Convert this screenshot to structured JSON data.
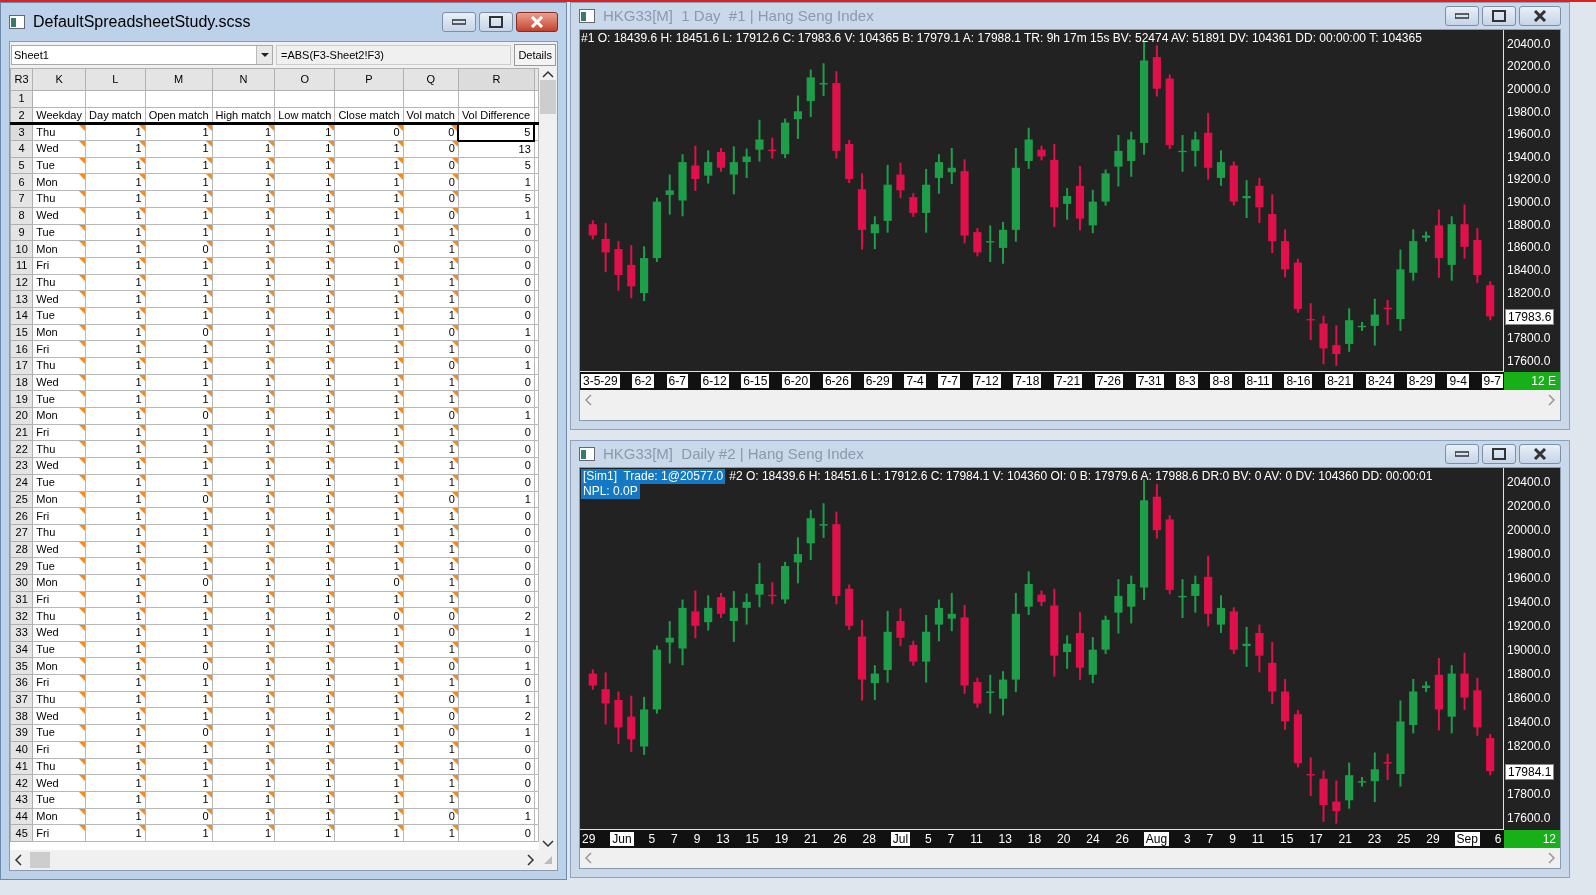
{
  "spreadsheet_window": {
    "title": "DefaultSpreadsheetStudy.scss",
    "active": true,
    "sheet_selector": "Sheet1",
    "formula": "=ABS(F3-Sheet2!F3)",
    "details_button": "Details",
    "cell_reference": "R3",
    "columns": [
      {
        "label": "K",
        "marked": true,
        "selected": false
      },
      {
        "label": "L",
        "marked": true,
        "selected": false
      },
      {
        "label": "M",
        "marked": true,
        "selected": false
      },
      {
        "label": "N",
        "marked": true,
        "selected": false
      },
      {
        "label": "O",
        "marked": true,
        "selected": false
      },
      {
        "label": "P",
        "marked": true,
        "selected": false
      },
      {
        "label": "Q",
        "marked": true,
        "selected": false
      },
      {
        "label": "R",
        "marked": false,
        "selected": true
      }
    ],
    "rows": [
      {
        "header": "1",
        "kind": "blank",
        "selected": false
      },
      {
        "header": "2",
        "kind": "header",
        "selected": false,
        "cells": [
          "Weekday",
          "Day match",
          "Open match",
          "High match",
          "Low match",
          "Close match",
          "Vol match",
          "Vol Difference"
        ]
      },
      {
        "header": "3",
        "kind": "data",
        "selected": true,
        "cells": [
          "Thu",
          "1",
          "1",
          "1",
          "1",
          "0",
          "0",
          "5"
        ]
      },
      {
        "header": "4",
        "kind": "data",
        "selected": false,
        "cells": [
          "Wed",
          "1",
          "1",
          "1",
          "1",
          "1",
          "0",
          "13"
        ]
      },
      {
        "header": "5",
        "kind": "data",
        "selected": false,
        "cells": [
          "Tue",
          "1",
          "1",
          "1",
          "1",
          "1",
          "0",
          "5"
        ]
      },
      {
        "header": "6",
        "kind": "data",
        "selected": false,
        "cells": [
          "Mon",
          "1",
          "1",
          "1",
          "1",
          "1",
          "0",
          "1"
        ]
      },
      {
        "header": "7",
        "kind": "data",
        "selected": false,
        "cells": [
          "Thu",
          "1",
          "1",
          "1",
          "1",
          "1",
          "0",
          "5"
        ]
      },
      {
        "header": "8",
        "kind": "data",
        "selected": false,
        "cells": [
          "Wed",
          "1",
          "1",
          "1",
          "1",
          "1",
          "0",
          "1"
        ]
      },
      {
        "header": "9",
        "kind": "data",
        "selected": false,
        "cells": [
          "Tue",
          "1",
          "1",
          "1",
          "1",
          "1",
          "1",
          "0"
        ]
      },
      {
        "header": "10",
        "kind": "data",
        "selected": false,
        "cells": [
          "Mon",
          "1",
          "0",
          "1",
          "1",
          "0",
          "1",
          "0"
        ]
      },
      {
        "header": "11",
        "kind": "data",
        "selected": false,
        "cells": [
          "Fri",
          "1",
          "1",
          "1",
          "1",
          "1",
          "1",
          "0"
        ]
      },
      {
        "header": "12",
        "kind": "data",
        "selected": false,
        "cells": [
          "Thu",
          "1",
          "1",
          "1",
          "1",
          "1",
          "1",
          "0"
        ]
      },
      {
        "header": "13",
        "kind": "data",
        "selected": false,
        "cells": [
          "Wed",
          "1",
          "1",
          "1",
          "1",
          "1",
          "1",
          "0"
        ]
      },
      {
        "header": "14",
        "kind": "data",
        "selected": false,
        "cells": [
          "Tue",
          "1",
          "1",
          "1",
          "1",
          "1",
          "1",
          "0"
        ]
      },
      {
        "header": "15",
        "kind": "data",
        "selected": false,
        "cells": [
          "Mon",
          "1",
          "0",
          "1",
          "1",
          "1",
          "0",
          "1"
        ]
      },
      {
        "header": "16",
        "kind": "data",
        "selected": false,
        "cells": [
          "Fri",
          "1",
          "1",
          "1",
          "1",
          "1",
          "1",
          "0"
        ]
      },
      {
        "header": "17",
        "kind": "data",
        "selected": false,
        "cells": [
          "Thu",
          "1",
          "1",
          "1",
          "1",
          "1",
          "0",
          "1"
        ]
      },
      {
        "header": "18",
        "kind": "data",
        "selected": false,
        "cells": [
          "Wed",
          "1",
          "1",
          "1",
          "1",
          "1",
          "1",
          "0"
        ]
      },
      {
        "header": "19",
        "kind": "data",
        "selected": false,
        "cells": [
          "Tue",
          "1",
          "1",
          "1",
          "1",
          "1",
          "1",
          "0"
        ]
      },
      {
        "header": "20",
        "kind": "data",
        "selected": false,
        "cells": [
          "Mon",
          "1",
          "0",
          "1",
          "1",
          "1",
          "0",
          "1"
        ]
      },
      {
        "header": "21",
        "kind": "data",
        "selected": false,
        "cells": [
          "Fri",
          "1",
          "1",
          "1",
          "1",
          "1",
          "1",
          "0"
        ]
      },
      {
        "header": "22",
        "kind": "data",
        "selected": false,
        "cells": [
          "Thu",
          "1",
          "1",
          "1",
          "1",
          "1",
          "1",
          "0"
        ]
      },
      {
        "header": "23",
        "kind": "data",
        "selected": false,
        "cells": [
          "Wed",
          "1",
          "1",
          "1",
          "1",
          "1",
          "1",
          "0"
        ]
      },
      {
        "header": "24",
        "kind": "data",
        "selected": false,
        "cells": [
          "Tue",
          "1",
          "1",
          "1",
          "1",
          "1",
          "1",
          "0"
        ]
      },
      {
        "header": "25",
        "kind": "data",
        "selected": false,
        "cells": [
          "Mon",
          "1",
          "0",
          "1",
          "1",
          "1",
          "0",
          "1"
        ]
      },
      {
        "header": "26",
        "kind": "data",
        "selected": false,
        "cells": [
          "Fri",
          "1",
          "1",
          "1",
          "1",
          "1",
          "1",
          "0"
        ]
      },
      {
        "header": "27",
        "kind": "data",
        "selected": false,
        "cells": [
          "Thu",
          "1",
          "1",
          "1",
          "1",
          "1",
          "1",
          "0"
        ]
      },
      {
        "header": "28",
        "kind": "data",
        "selected": false,
        "cells": [
          "Wed",
          "1",
          "1",
          "1",
          "1",
          "1",
          "1",
          "0"
        ]
      },
      {
        "header": "29",
        "kind": "data",
        "selected": false,
        "cells": [
          "Tue",
          "1",
          "1",
          "1",
          "1",
          "1",
          "1",
          "0"
        ]
      },
      {
        "header": "30",
        "kind": "data",
        "selected": false,
        "cells": [
          "Mon",
          "1",
          "0",
          "1",
          "1",
          "0",
          "1",
          "0"
        ]
      },
      {
        "header": "31",
        "kind": "data",
        "selected": false,
        "cells": [
          "Fri",
          "1",
          "1",
          "1",
          "1",
          "1",
          "1",
          "0"
        ]
      },
      {
        "header": "32",
        "kind": "data",
        "selected": false,
        "cells": [
          "Thu",
          "1",
          "1",
          "1",
          "1",
          "0",
          "0",
          "2"
        ]
      },
      {
        "header": "33",
        "kind": "data",
        "selected": false,
        "cells": [
          "Wed",
          "1",
          "1",
          "1",
          "1",
          "1",
          "0",
          "1"
        ]
      },
      {
        "header": "34",
        "kind": "data",
        "selected": false,
        "cells": [
          "Tue",
          "1",
          "1",
          "1",
          "1",
          "1",
          "1",
          "0"
        ]
      },
      {
        "header": "35",
        "kind": "data",
        "selected": false,
        "cells": [
          "Mon",
          "1",
          "0",
          "1",
          "1",
          "1",
          "0",
          "1"
        ]
      },
      {
        "header": "36",
        "kind": "data",
        "selected": false,
        "cells": [
          "Fri",
          "1",
          "1",
          "1",
          "1",
          "1",
          "1",
          "0"
        ]
      },
      {
        "header": "37",
        "kind": "data",
        "selected": false,
        "cells": [
          "Thu",
          "1",
          "1",
          "1",
          "1",
          "1",
          "0",
          "1"
        ]
      },
      {
        "header": "38",
        "kind": "data",
        "selected": false,
        "cells": [
          "Wed",
          "1",
          "1",
          "1",
          "1",
          "1",
          "0",
          "2"
        ]
      },
      {
        "header": "39",
        "kind": "data",
        "selected": false,
        "cells": [
          "Tue",
          "1",
          "0",
          "1",
          "1",
          "1",
          "0",
          "1"
        ]
      },
      {
        "header": "40",
        "kind": "data",
        "selected": false,
        "cells": [
          "Fri",
          "1",
          "1",
          "1",
          "1",
          "1",
          "1",
          "0"
        ]
      },
      {
        "header": "41",
        "kind": "data",
        "selected": false,
        "cells": [
          "Thu",
          "1",
          "1",
          "1",
          "1",
          "1",
          "1",
          "0"
        ]
      },
      {
        "header": "42",
        "kind": "data",
        "selected": false,
        "cells": [
          "Wed",
          "1",
          "1",
          "1",
          "1",
          "1",
          "1",
          "0"
        ]
      },
      {
        "header": "43",
        "kind": "data",
        "selected": false,
        "cells": [
          "Tue",
          "1",
          "1",
          "1",
          "1",
          "1",
          "1",
          "0"
        ]
      },
      {
        "header": "44",
        "kind": "data",
        "selected": false,
        "cells": [
          "Mon",
          "1",
          "0",
          "1",
          "1",
          "1",
          "0",
          "1"
        ]
      },
      {
        "header": "45",
        "kind": "data",
        "selected": false,
        "cells": [
          "Fri",
          "1",
          "1",
          "1",
          "1",
          "1",
          "1",
          "0"
        ]
      }
    ]
  },
  "charts": [
    {
      "title": "HKG33[M]  1 Day  #1 | Hang Seng Index",
      "active": false,
      "info": "#1 O: 18439.6 H: 18451.6 L: 17912.6 C: 17983.6 V: 104365 B: 17979.1 A: 17988.1 TR: 9h 17m 15s BV: 52474 AV: 51891 DV: 104361 DD: 00:00:00 T: 104365",
      "price_labels": [
        "20400.0",
        "20200.0",
        "20000.0",
        "19800.0",
        "19600.0",
        "19400.0",
        "19200.0",
        "19000.0",
        "18800.0",
        "18600.0",
        "18400.0",
        "18200.0",
        "17800.0",
        "17600.0"
      ],
      "current_price": "17983.6",
      "corner_label": "12 E",
      "date_labels": [
        {
          "text": "3-5-29",
          "kind": "boxed"
        },
        {
          "text": "6-2",
          "kind": "boxed"
        },
        {
          "text": "6-7",
          "kind": "boxed"
        },
        {
          "text": "6-12",
          "kind": "boxed"
        },
        {
          "text": "6-15",
          "kind": "boxed"
        },
        {
          "text": "6-20",
          "kind": "boxed"
        },
        {
          "text": "6-26",
          "kind": "boxed"
        },
        {
          "text": "6-29",
          "kind": "boxed"
        },
        {
          "text": "7-4",
          "kind": "boxed"
        },
        {
          "text": "7-7",
          "kind": "boxed"
        },
        {
          "text": "7-12",
          "kind": "boxed"
        },
        {
          "text": "7-18",
          "kind": "boxed"
        },
        {
          "text": "7-21",
          "kind": "boxed"
        },
        {
          "text": "7-26",
          "kind": "boxed"
        },
        {
          "text": "7-31",
          "kind": "boxed"
        },
        {
          "text": "8-3",
          "kind": "boxed"
        },
        {
          "text": "8-8",
          "kind": "boxed"
        },
        {
          "text": "8-11",
          "kind": "boxed"
        },
        {
          "text": "8-16",
          "kind": "boxed"
        },
        {
          "text": "8-21",
          "kind": "boxed"
        },
        {
          "text": "8-24",
          "kind": "boxed"
        },
        {
          "text": "8-29",
          "kind": "boxed"
        },
        {
          "text": "9-4",
          "kind": "boxed"
        },
        {
          "text": "9-7",
          "kind": "boxed"
        }
      ]
    },
    {
      "title": "HKG33[M]  Daily #2 | Hang Seng Index",
      "active": false,
      "trade_badge": "[Sim1]  Trade: 1@20577.0",
      "info": "#2 O: 18439.6 H: 18451.6 L: 17912.6 C: 17984.1 V: 104360 OI: 0 B: 17979.6 A: 17988.6 DR:0 BV: 0 AV: 0 DV: 104360 DD: 00:00:01",
      "npl": "NPL: 0.0P",
      "price_labels": [
        "20400.0",
        "20200.0",
        "20000.0",
        "19800.0",
        "19600.0",
        "19400.0",
        "19200.0",
        "19000.0",
        "18800.0",
        "18600.0",
        "18400.0",
        "18200.0",
        "17800.0",
        "17600.0"
      ],
      "current_price": "17984.1",
      "corner_label": "12",
      "date_labels": [
        {
          "text": "29",
          "kind": "day"
        },
        {
          "text": "Jun",
          "kind": "month"
        },
        {
          "text": "5",
          "kind": "day"
        },
        {
          "text": "7",
          "kind": "day"
        },
        {
          "text": "9",
          "kind": "day"
        },
        {
          "text": "13",
          "kind": "day"
        },
        {
          "text": "15",
          "kind": "day"
        },
        {
          "text": "19",
          "kind": "day"
        },
        {
          "text": "21",
          "kind": "day"
        },
        {
          "text": "26",
          "kind": "day"
        },
        {
          "text": "28",
          "kind": "day"
        },
        {
          "text": "Jul",
          "kind": "month"
        },
        {
          "text": "5",
          "kind": "day"
        },
        {
          "text": "7",
          "kind": "day"
        },
        {
          "text": "11",
          "kind": "day"
        },
        {
          "text": "13",
          "kind": "day"
        },
        {
          "text": "18",
          "kind": "day"
        },
        {
          "text": "20",
          "kind": "day"
        },
        {
          "text": "24",
          "kind": "day"
        },
        {
          "text": "26",
          "kind": "day"
        },
        {
          "text": "Aug",
          "kind": "month"
        },
        {
          "text": "3",
          "kind": "day"
        },
        {
          "text": "7",
          "kind": "day"
        },
        {
          "text": "9",
          "kind": "day"
        },
        {
          "text": "11",
          "kind": "day"
        },
        {
          "text": "15",
          "kind": "day"
        },
        {
          "text": "17",
          "kind": "day"
        },
        {
          "text": "21",
          "kind": "day"
        },
        {
          "text": "23",
          "kind": "day"
        },
        {
          "text": "25",
          "kind": "day"
        },
        {
          "text": "29",
          "kind": "day"
        },
        {
          "text": "Sep",
          "kind": "month"
        },
        {
          "text": "6",
          "kind": "day"
        }
      ]
    }
  ]
}
